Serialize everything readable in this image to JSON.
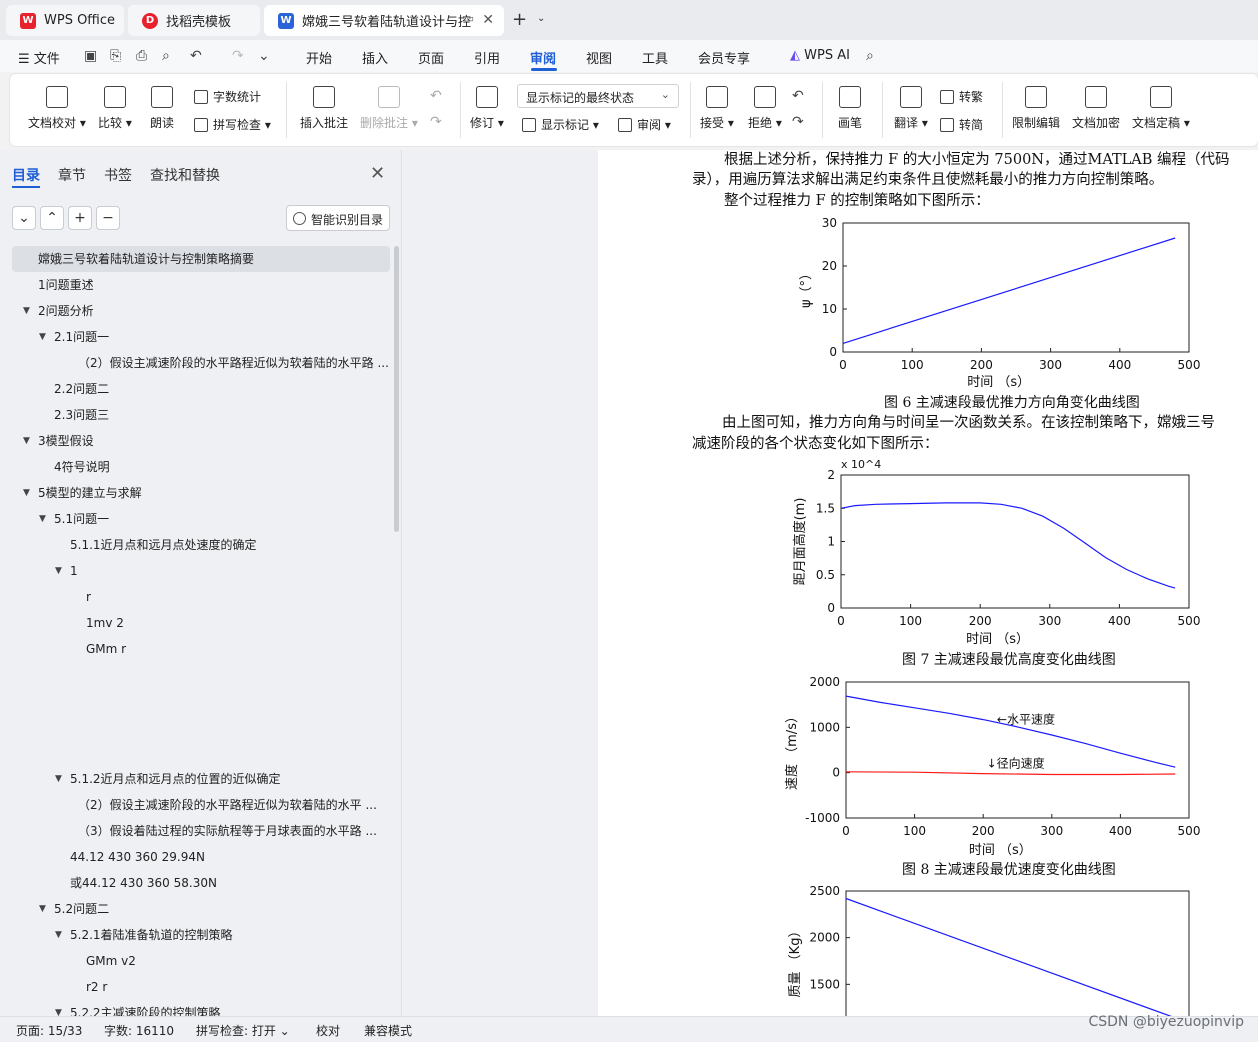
{
  "tabs": [
    {
      "label": "WPS Office",
      "icon": "wps-logo-icon"
    },
    {
      "label": "找稻壳模板",
      "icon": "docer-icon"
    },
    {
      "label": "嫦娥三号软着陆轨道设计与控",
      "icon": "word-doc-icon"
    }
  ],
  "menu": {
    "file": "文件",
    "items": [
      "开始",
      "插入",
      "页面",
      "引用",
      "审阅",
      "视图",
      "工具",
      "会员专享"
    ],
    "active": "审阅",
    "wps_ai": "WPS AI"
  },
  "ribbon": {
    "doc_check": "文档校对",
    "compare": "比较",
    "read_aloud": "朗读",
    "word_count": "字数统计",
    "spell_check": "拼写检查",
    "insert_comment": "插入批注",
    "delete_comment": "删除批注",
    "revise": "修订",
    "track_state": "显示标记的最终状态",
    "show_markup": "显示标记",
    "review": "审阅",
    "accept": "接受",
    "reject": "拒绝",
    "pen": "画笔",
    "translate": "翻译",
    "to_traditional": "转繁",
    "to_simplified": "转简",
    "restrict_edit": "限制编辑",
    "encrypt": "文档加密",
    "finalize": "文档定稿"
  },
  "nav": {
    "tabs": [
      "目录",
      "章节",
      "书签",
      "查找和替换"
    ],
    "smart_toc": "智能识别目录",
    "toc": [
      {
        "text": "嫦娥三号软着陆轨道设计与控制策略摘要",
        "level": 0,
        "arrow": "",
        "selected": true
      },
      {
        "text": "1问题重述",
        "level": 0,
        "arrow": ""
      },
      {
        "text": "2问题分析",
        "level": 0,
        "arrow": "▼"
      },
      {
        "text": "2.1问题一",
        "level": 1,
        "arrow": "▼"
      },
      {
        "text": "（2）假设主减速阶段的水平路程近似为软着陆的水平路 ...",
        "level": 3,
        "arrow": ""
      },
      {
        "text": "2.2问题二",
        "level": 1,
        "arrow": ""
      },
      {
        "text": "2.3问题三",
        "level": 1,
        "arrow": ""
      },
      {
        "text": "3模型假设",
        "level": 0,
        "arrow": "▼"
      },
      {
        "text": "4符号说明",
        "level": 1,
        "arrow": ""
      },
      {
        "text": "5模型的建立与求解",
        "level": 0,
        "arrow": "▼"
      },
      {
        "text": "5.1问题一",
        "level": 1,
        "arrow": "▼"
      },
      {
        "text": "5.1.1近月点和远月点处速度的确定",
        "level": 2,
        "arrow": ""
      },
      {
        "text": "1",
        "level": 2,
        "arrow": "▼"
      },
      {
        "text": "r",
        "level": 3,
        "arrow": ""
      },
      {
        "text": "1mv 2",
        "level": 3,
        "arrow": ""
      },
      {
        "text": "GMm r",
        "level": 3,
        "arrow": ""
      },
      {
        "text": "",
        "level": 3,
        "arrow": ""
      },
      {
        "text": "",
        "level": 3,
        "arrow": ""
      },
      {
        "text": "",
        "level": 3,
        "arrow": ""
      },
      {
        "text": "",
        "level": 3,
        "arrow": ""
      },
      {
        "text": "5.1.2近月点和远月点的位置的近似确定",
        "level": 2,
        "arrow": "▼"
      },
      {
        "text": "（2）假设主减速阶段的水平路程近似为软着陆的水平 ...",
        "level": 3,
        "arrow": ""
      },
      {
        "text": "（3）假设着陆过程的实际航程等于月球表面的水平路 ...",
        "level": 3,
        "arrow": ""
      },
      {
        "text": "44.12      430      360      29.94N",
        "level": 2,
        "arrow": ""
      },
      {
        "text": "或44.12      430      360      58.30N",
        "level": 2,
        "arrow": ""
      },
      {
        "text": "5.2问题二",
        "level": 1,
        "arrow": "▼"
      },
      {
        "text": "5.2.1着陆准备轨道的控制策略",
        "level": 2,
        "arrow": "▼"
      },
      {
        "text": "GMm v2",
        "level": 3,
        "arrow": ""
      },
      {
        "text": "r2 r",
        "level": 3,
        "arrow": ""
      },
      {
        "text": "5.2.2主减速阶段的控制策略",
        "level": 2,
        "arrow": "▼"
      }
    ]
  },
  "document": {
    "p1a": "根据上述分析，保持推力 F 的大小恒定为 7500N，通过MATLAB 编程（代码",
    "p1b": "录），用遍历算法求解出满足约束条件且使燃耗最小的推力方向控制策略。",
    "p2": "整个过程推力 F 的控制策略如下图所示：",
    "cap6": "图 6 主减速段最优推力方向角变化曲线图",
    "p3a": "由上图可知，推力方向角与时间呈一次函数关系。在该控制策略下，嫦娥三号",
    "p3b": "减速阶段的各个状态变化如下图所示：",
    "cap7": "图 7 主减速段最优高度变化曲线图",
    "cap8": "图 8 主减速段最优速度变化曲线图"
  },
  "chart_data": [
    {
      "type": "line",
      "title": "",
      "xlabel": "时间 （s）",
      "ylabel": "ψ（°）",
      "xlim": [
        0,
        500
      ],
      "ylim": [
        0,
        30
      ],
      "xticks": [
        0,
        100,
        200,
        300,
        400,
        500
      ],
      "yticks": [
        0,
        10,
        20,
        30
      ],
      "series": [
        {
          "color": "#1a1aff",
          "x": [
            0,
            480
          ],
          "y": [
            2,
            26.5
          ]
        }
      ]
    },
    {
      "type": "line",
      "title": "",
      "xlabel": "时间 （s）",
      "ylabel": "距月面高度(m)",
      "y_multiplier": "x 10^4",
      "xlim": [
        0,
        500
      ],
      "ylim": [
        0,
        2
      ],
      "xticks": [
        0,
        100,
        200,
        300,
        400,
        500
      ],
      "yticks": [
        0,
        0.5,
        1,
        1.5,
        2
      ],
      "series": [
        {
          "color": "#1a1aff",
          "x": [
            0,
            20,
            50,
            100,
            150,
            200,
            230,
            260,
            290,
            320,
            350,
            380,
            410,
            440,
            470,
            480
          ],
          "y": [
            1.5,
            1.54,
            1.56,
            1.57,
            1.58,
            1.58,
            1.56,
            1.5,
            1.38,
            1.2,
            0.98,
            0.76,
            0.58,
            0.44,
            0.33,
            0.3
          ]
        }
      ]
    },
    {
      "type": "line",
      "title": "",
      "xlabel": "时间 （s）",
      "ylabel": "速度 （m/s）",
      "xlim": [
        0,
        500
      ],
      "ylim": [
        -1000,
        2000
      ],
      "xticks": [
        0,
        100,
        200,
        300,
        400,
        500
      ],
      "yticks": [
        -1000,
        0,
        1000,
        2000
      ],
      "series": [
        {
          "color": "#1a1aff",
          "x": [
            0,
            50,
            100,
            150,
            200,
            250,
            300,
            350,
            400,
            450,
            480
          ],
          "y": [
            1690,
            1550,
            1430,
            1310,
            1170,
            1010,
            830,
            640,
            430,
            230,
            120
          ]
        },
        {
          "color": "#ff1a1a",
          "x": [
            0,
            100,
            200,
            300,
            400,
            480
          ],
          "y": [
            20,
            10,
            -20,
            -40,
            -40,
            -30
          ]
        }
      ],
      "annotations": [
        {
          "text": "←水平速度",
          "x": 220,
          "y": 1080
        },
        {
          "text": "↓径向速度",
          "x": 205,
          "y": 110
        }
      ]
    },
    {
      "type": "line",
      "title": "",
      "xlabel": "",
      "ylabel": "质量 （Kg）",
      "xlim": [
        0,
        500
      ],
      "ylim": [
        1000,
        2500
      ],
      "xticks": [],
      "yticks": [
        1500,
        2000,
        2500
      ],
      "series": [
        {
          "color": "#1a1aff",
          "x": [
            0,
            480
          ],
          "y": [
            2420,
            1140
          ]
        }
      ]
    }
  ],
  "status": {
    "page": "页面: 15/33",
    "words": "字数: 16110",
    "spell": "拼写检查: 打开",
    "proof": "校对",
    "compat": "兼容模式"
  },
  "watermark": "CSDN @biyezuopinvip",
  "colors": {
    "accent": "#1e5fd6",
    "wps_red": "#e8222d",
    "doc_blue": "#2b63d9"
  }
}
